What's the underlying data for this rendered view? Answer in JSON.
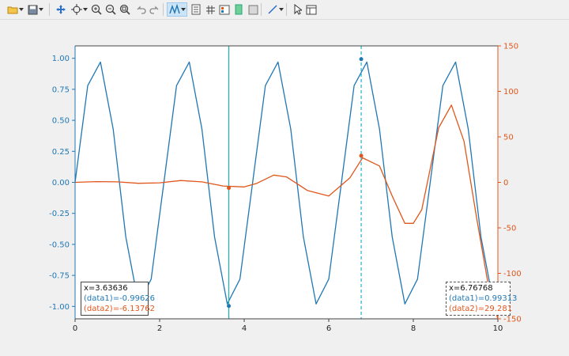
{
  "colors": {
    "series1": "#1f77b4",
    "series2": "#e0561b",
    "cursor1": "#19b2a8",
    "cursor2": "#19b5c9",
    "tip_x_text": "#111111"
  },
  "toolbar": {
    "buttons": [
      {
        "name": "open-file-icon",
        "has_menu": true
      },
      {
        "name": "save-icon",
        "has_menu": true
      },
      {
        "name": "pan-icon",
        "has_menu": false
      },
      {
        "name": "data-cursor-icon",
        "has_menu": true
      },
      {
        "name": "zoom-in-icon",
        "has_menu": false
      },
      {
        "name": "zoom-out-icon",
        "has_menu": false
      },
      {
        "name": "zoom-fit-icon",
        "has_menu": false
      },
      {
        "name": "undo-icon",
        "has_menu": false
      },
      {
        "name": "redo-icon",
        "has_menu": false
      },
      {
        "name": "data-tips-icon",
        "has_menu": true,
        "selected": true
      },
      {
        "name": "legend-icon",
        "has_menu": false
      },
      {
        "name": "grid-icon",
        "has_menu": false
      },
      {
        "name": "properties-icon",
        "has_menu": false
      },
      {
        "name": "colorbar-icon",
        "has_menu": false
      },
      {
        "name": "box-icon",
        "has_menu": false
      },
      {
        "name": "line-tool-icon",
        "has_menu": true
      },
      {
        "name": "select-arrow-icon",
        "has_menu": false
      },
      {
        "name": "panel-icon",
        "has_menu": false
      }
    ]
  },
  "chart_data": {
    "type": "line",
    "x_range": [
      0,
      10
    ],
    "left_axis": {
      "range": [
        -1.1,
        1.1
      ],
      "ticks": [
        -1.0,
        -0.75,
        -0.5,
        -0.25,
        0.0,
        0.25,
        0.5,
        0.75,
        1.0
      ],
      "tick_labels": [
        "-1.00",
        "-0.75",
        "-0.50",
        "-0.25",
        "0.00",
        "0.25",
        "0.50",
        "0.75",
        "1.00"
      ]
    },
    "right_axis": {
      "range": [
        -150,
        150
      ],
      "ticks": [
        -150,
        -100,
        -50,
        0,
        50,
        100,
        150
      ],
      "tick_labels": [
        "-150",
        "-100",
        "-50",
        "0",
        "50",
        "100",
        "150"
      ]
    },
    "x_ticks": [
      0,
      2,
      4,
      6,
      8,
      10
    ],
    "x_tick_labels": [
      "0",
      "2",
      "4",
      "6",
      "8",
      "10"
    ],
    "grid": false,
    "series": [
      {
        "axis": "left",
        "x": [
          0,
          0.3,
          0.6,
          0.9,
          1.2,
          1.5,
          1.8,
          2.1,
          2.4,
          2.7,
          3.0,
          3.3,
          3.6,
          3.9,
          4.2,
          4.5,
          4.8,
          5.1,
          5.4,
          5.7,
          6.0,
          6.3,
          6.6,
          6.9,
          7.2,
          7.5,
          7.8,
          8.1,
          8.4,
          8.7,
          9.0,
          9.3,
          9.6,
          9.9,
          10.0
        ],
        "y": [
          0,
          0.78,
          0.97,
          0.43,
          -0.44,
          -0.98,
          -0.78,
          0,
          0.78,
          0.97,
          0.43,
          -0.44,
          -0.98,
          -0.78,
          0,
          0.78,
          0.97,
          0.43,
          -0.44,
          -0.98,
          -0.78,
          0,
          0.78,
          0.97,
          0.43,
          -0.44,
          -0.98,
          -0.78,
          0,
          0.78,
          0.97,
          0.43,
          -0.44,
          -0.98,
          -0.98
        ]
      },
      {
        "axis": "right",
        "x": [
          0,
          0.5,
          1.0,
          1.5,
          2.0,
          2.5,
          3.0,
          3.5,
          4.0,
          4.3,
          4.7,
          5.0,
          5.5,
          6.0,
          6.5,
          6.8,
          7.2,
          7.5,
          7.8,
          8.0,
          8.2,
          8.6,
          8.9,
          9.2,
          9.5,
          9.8,
          10.0
        ],
        "y": [
          0,
          0.8,
          0.5,
          -1,
          -0.5,
          2,
          0.5,
          -4,
          -5,
          -1,
          8,
          6,
          -9,
          -15,
          5,
          27,
          18,
          -15,
          -45,
          -45,
          -30,
          60,
          85,
          45,
          -40,
          -120,
          -150
        ]
      }
    ],
    "cursors": [
      {
        "x": 3.63636,
        "tip": {
          "x_label": "x=3.63636",
          "d1_label": "(data1)=-0.99626",
          "d2_label": "(data2)=-6.13762"
        },
        "points": {
          "y1": -0.99626,
          "y2": -6.13762
        }
      },
      {
        "x": 6.76768,
        "tip": {
          "x_label": "x=6.76768",
          "d1_label": "(data1)=0.99313",
          "d2_label": "(data2)=29.281"
        },
        "points": {
          "y1": 0.99313,
          "y2": 29.281
        }
      }
    ]
  }
}
